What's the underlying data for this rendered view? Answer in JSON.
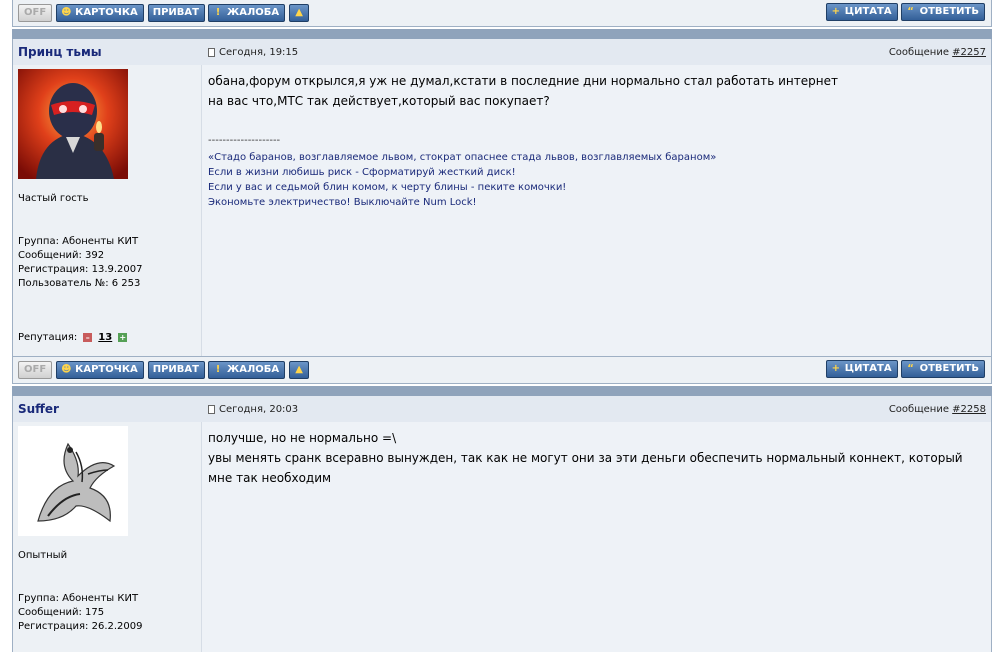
{
  "buttons": {
    "off": "OFF",
    "card": "КАРТОЧКА",
    "private": "ПРИВАТ",
    "complaint": "ЖАЛОБА",
    "quote": "ЦИТАТА",
    "reply": "ОТВЕТИТЬ"
  },
  "posts": [
    {
      "author": "Принц тьмы",
      "date": "Сегодня, 19:15",
      "message_label": "Сообщение",
      "message_number": "#2257",
      "rank": "Частый гость",
      "group": "Группа: Абоненты КИТ",
      "posts": "Сообщений: 392",
      "registered": "Регистрация: 13.9.2007",
      "user_no": "Пользователь №: 6 253",
      "reputation_label": "Репутация:",
      "reputation_value": "13",
      "text_lines": [
        "обана,форум открылся,я уж не думал,кстати в последние дни нормально стал работать интернет",
        "на вас что,МТС так действует,который вас покупает?"
      ],
      "signature_sep": "--------------------",
      "signature_lines": [
        "«Стадо баранов, возглавляемое львом, стократ опаснее стада львов, возглавляемых бараном»",
        "Если в жизни любишь риск - Сформатируй жесткий диск!",
        "Если у вас и седьмой блин комом, к черту блины - пеките комочки!",
        "Экономьте электричество! Выключайте Num Lock!"
      ]
    },
    {
      "author": "Suffer",
      "date": "Сегодня, 20:03",
      "message_label": "Сообщение",
      "message_number": "#2258",
      "rank": "Опытный",
      "group": "Группа: Абоненты КИТ",
      "posts": "Сообщений: 175",
      "registered": "Регистрация: 26.2.2009",
      "text_lines": [
        "получше, но не нормально =\\",
        "увы менять сранк всеравно вынужден, так как не могут они за эти деньги обеспечить нормальный коннект, который",
        "мне так необходим"
      ]
    }
  ],
  "icons": {
    "card": "user-icon",
    "complaint": "exclamation-icon",
    "top": "arrow-up-icon",
    "quote": "plus-icon",
    "reply": "quote-marks-icon"
  }
}
